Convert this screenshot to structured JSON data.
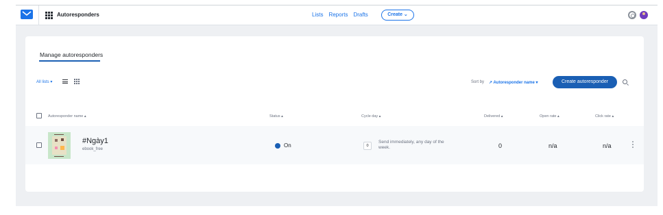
{
  "header": {
    "app_title": "Autoresponders",
    "nav": [
      "Lists",
      "Reports",
      "Drafts"
    ],
    "create_label": "Create ⌄",
    "logo_icon": "envelope-icon",
    "apps_icon": "apps-grid-icon",
    "help_icon": "lifebuoy-icon",
    "avatar_icon": "avatar"
  },
  "card": {
    "title": "Manage autoresponders",
    "all_lists_label": "All lists ▾",
    "sort_by_label": "Sort by",
    "sort_value": "↗ Autoresponder name ▾",
    "create_button": "Create autoresponder"
  },
  "table": {
    "columns": {
      "name": "Autoresponder name ▴",
      "status": "Status ▴",
      "cycle_day": "Cycle day ▴",
      "delivered": "Delivered ▴",
      "open_rate": "Open rate ▴",
      "click_rate": "Click rate ▴"
    },
    "rows": [
      {
        "name": "#Ngày1",
        "list": "ebook_free",
        "status": "On",
        "cycle_day": "0",
        "cycle_text": "Send immediately, any day of the week.",
        "delivered": "0",
        "open_rate": "n/a",
        "click_rate": "n/a"
      }
    ]
  },
  "colors": {
    "accent": "#1a73e8",
    "primary_button": "#1a5fb4",
    "page_bg": "#eef0f3"
  }
}
